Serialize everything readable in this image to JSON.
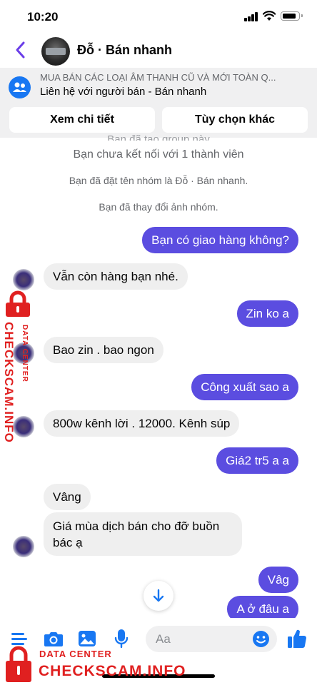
{
  "status_bar": {
    "time": "10:20"
  },
  "header": {
    "title": "Đỗ · Bán nhanh"
  },
  "banner": {
    "line1": "MUA BÁN CÁC LOẠI ÂM THANH CŨ VÀ MỚI TOÀN Q...",
    "line2": "Liên hệ với người bán - Bán nhanh",
    "details_button": "Xem chi tiết",
    "options_button": "Tùy chọn khác"
  },
  "system_notes": [
    "Bạn đã tạo group này",
    "Bạn chưa kết nối với 1 thành viên",
    "Bạn đã đặt tên nhóm là Đỗ · Bán nhanh.",
    "Bạn đã thay đổi ảnh nhóm."
  ],
  "messages": [
    {
      "from": "me",
      "text": "Bạn có giao hàng không?"
    },
    {
      "from": "them",
      "text": "Vẫn còn hàng bạn nhé."
    },
    {
      "from": "me",
      "text": "Zin ko a"
    },
    {
      "from": "them",
      "text": "Bao zin .  bao ngon"
    },
    {
      "from": "me",
      "text": "Công xuất sao a"
    },
    {
      "from": "them",
      "text": "800w kênh lời .  12000. Kênh súp"
    },
    {
      "from": "me",
      "text": "Giá2 tr5 a a"
    },
    {
      "from": "them",
      "text": "Vâng"
    },
    {
      "from": "them",
      "text": "Giá mùa dịch bán cho đỡ buồn bác ạ"
    },
    {
      "from": "me",
      "text": "Vâg"
    },
    {
      "from": "me",
      "text": "A ở đâu a"
    }
  ],
  "composer": {
    "placeholder": "Aa"
  },
  "watermark": {
    "small": "DATA CENTER",
    "big": "CHECKSCAM.INFO"
  },
  "colors": {
    "accent": "#5b4de0",
    "brand_blue": "#1877f2",
    "watermark_red": "#e02020"
  },
  "icons": [
    "back-arrow-icon",
    "group-icon",
    "menu-icon",
    "camera-icon",
    "image-icon",
    "microphone-icon",
    "emoji-icon",
    "like-thumb-icon",
    "arrow-down-icon",
    "lock-icon"
  ]
}
